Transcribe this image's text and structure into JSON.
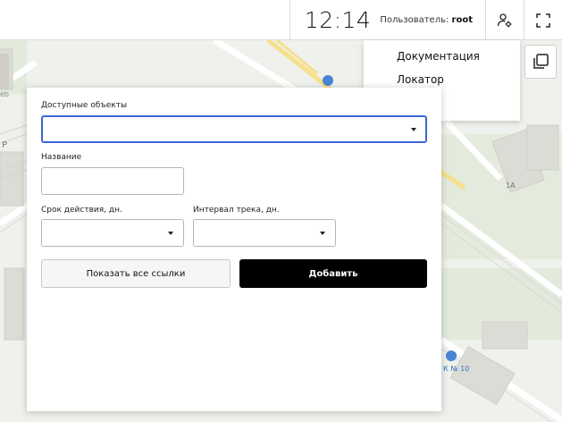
{
  "header": {
    "time": "12:14",
    "user_label": "Пользователь:",
    "user_name": "root",
    "settings_icon": "user-settings-icon",
    "fullscreen_icon": "fullscreen-icon"
  },
  "menu": {
    "items": [
      {
        "label": "Документация"
      },
      {
        "label": "Локатор"
      }
    ]
  },
  "map": {
    "labels": [
      "1А",
      "К № 10",
      "Р",
      "еb"
    ],
    "layers_icon": "layers-icon"
  },
  "form": {
    "objects_label": "Доступные объекты",
    "objects_value": "",
    "name_label": "Название",
    "name_value": "",
    "validity_label": "Срок действия, дн.",
    "validity_value": "",
    "interval_label": "Интервал трека, дн.",
    "interval_value": "",
    "show_links_label": "Показать все ссылки",
    "add_label": "Добавить"
  },
  "colors": {
    "accent_focus": "#3a66d6",
    "primary_button": "#000000"
  }
}
